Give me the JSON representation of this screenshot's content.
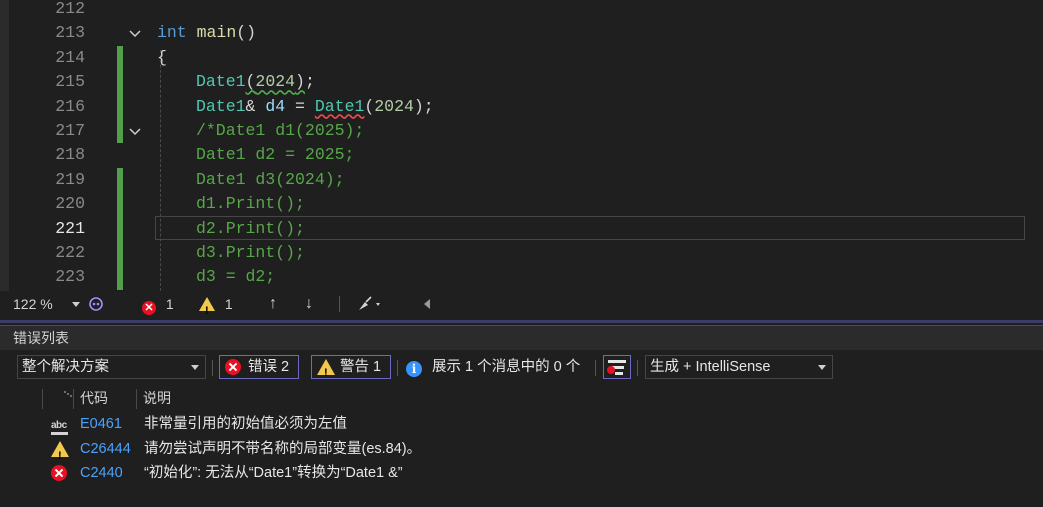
{
  "editor": {
    "lines": [
      {
        "num": "212"
      },
      {
        "num": "213"
      },
      {
        "num": "214"
      },
      {
        "num": "215"
      },
      {
        "num": "216"
      },
      {
        "num": "217"
      },
      {
        "num": "218"
      },
      {
        "num": "219"
      },
      {
        "num": "220"
      },
      {
        "num": "221"
      },
      {
        "num": "222"
      },
      {
        "num": "223"
      }
    ],
    "code": {
      "l213_kw": "int",
      "l213_fn": "main",
      "l213_rest": "()",
      "l214": "{",
      "l215_type": "Date1",
      "l215_paren_open": "(",
      "l215_num": "2024",
      "l215_paren_close": ")",
      "l215_semi": ";",
      "l216_type": "Date1",
      "l216_amp": "& ",
      "l216_var": "d4",
      "l216_eq": " = ",
      "l216_type2": "Date1",
      "l216_paren": "(",
      "l216_num": "2024",
      "l216_end": ");",
      "l217": "/*Date1 d1(2025);",
      "l218": "Date1 d2 = 2025;",
      "l219": "Date1 d3(2024);",
      "l220": "d1.Print();",
      "l221": "d2.Print();",
      "l222": "d3.Print();",
      "l223": "d3 = d2;"
    }
  },
  "status_bar": {
    "zoom": "122 %",
    "error_count": "1",
    "warning_count": "1",
    "up_arrow": "↑",
    "down_arrow": "↓"
  },
  "error_list": {
    "title": "错误列表",
    "scope_dropdown": "整个解决方案",
    "errors_button": "错误 2",
    "warnings_button": "警告 1",
    "messages_text": "展示 1 个消息中的 0 个",
    "build_dropdown": "生成 + IntelliSense",
    "col_code": "代码",
    "col_desc": "说明",
    "abc_label": "abc",
    "rows": [
      {
        "icon": "spell-error-icon",
        "code": "E0461",
        "desc": "非常量引用的初始值必须为左值"
      },
      {
        "icon": "warning-icon",
        "code": "C26444",
        "desc": "请勿尝试声明不带名称的局部变量(es.84)。"
      },
      {
        "icon": "error-icon",
        "code": "C2440",
        "desc": "“初始化”: 无法从“Date1”转换为“Date1 &”"
      }
    ]
  },
  "colors": {
    "background": "#1f1f1f",
    "accent": "#6a6ac0",
    "change_bar": "#53a04c",
    "error": "#e81123",
    "warning": "#f2c94c",
    "link": "#4aa3ff"
  }
}
